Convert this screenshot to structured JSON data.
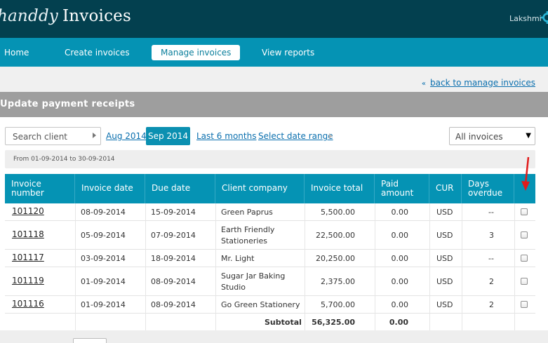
{
  "header": {
    "logo_brand": "handdy",
    "logo_product": "Invoices",
    "user_name": "Lakshmi"
  },
  "nav": {
    "items": [
      {
        "label": "Home"
      },
      {
        "label": "Create invoices"
      },
      {
        "label": "Manage invoices"
      },
      {
        "label": "View reports"
      }
    ],
    "active_index": 2
  },
  "subbar": {
    "back_label": "back to manage invoices"
  },
  "section": {
    "title": "Update payment receipts"
  },
  "filters": {
    "search_label": "Search client",
    "periods": [
      {
        "label": "Aug 2014"
      },
      {
        "label": "Sep 2014"
      },
      {
        "label": "Last 6 months"
      },
      {
        "label": "Select date range"
      }
    ],
    "active_period": "Sep 2014",
    "invoice_filter": "All invoices",
    "range_text": "From 01-09-2014 to 30-09-2014"
  },
  "table": {
    "headers": {
      "invoice_number": [
        "Invoice",
        "number"
      ],
      "invoice_date": "Invoice date",
      "due_date": "Due date",
      "client_company": "Client company",
      "invoice_total": "Invoice total",
      "paid_amount": [
        "Paid",
        "amount"
      ],
      "cur": "CUR",
      "days_overdue": [
        "Days",
        "overdue"
      ]
    },
    "rows": [
      {
        "number": "101120",
        "invoice_date": "08-09-2014",
        "due_date": "15-09-2014",
        "client": [
          "Green Paprus"
        ],
        "total": "5,500.00",
        "paid": "0.00",
        "cur": "USD",
        "overdue": "--"
      },
      {
        "number": "101118",
        "invoice_date": "05-09-2014",
        "due_date": "07-09-2014",
        "client": [
          "Earth Friendly",
          "Stationeries"
        ],
        "total": "22,500.00",
        "paid": "0.00",
        "cur": "USD",
        "overdue": "3"
      },
      {
        "number": "101117",
        "invoice_date": "03-09-2014",
        "due_date": "18-09-2014",
        "client": [
          "Mr. Light"
        ],
        "total": "20,250.00",
        "paid": "0.00",
        "cur": "USD",
        "overdue": "--"
      },
      {
        "number": "101119",
        "invoice_date": "01-09-2014",
        "due_date": "08-09-2014",
        "client": [
          "Sugar Jar Baking",
          "Studio"
        ],
        "total": "2,375.00",
        "paid": "0.00",
        "cur": "USD",
        "overdue": "2"
      },
      {
        "number": "101116",
        "invoice_date": "01-09-2014",
        "due_date": "08-09-2014",
        "client": [
          "Go Green Stationery"
        ],
        "total": "5,700.00",
        "paid": "0.00",
        "cur": "USD",
        "overdue": "2"
      }
    ],
    "subtotal_label": "Subtotal",
    "subtotal_total": "56,325.00",
    "subtotal_paid": "0.00"
  },
  "colors": {
    "header_bg": "#03404f",
    "nav_bg": "#0593b4",
    "link": "#0a6fae",
    "annotation_arrow": "#e11b1b"
  },
  "icons": {
    "settings": "gear-icon",
    "back": "double-chevron-left-icon",
    "annotation": "red-arrow-icon"
  }
}
